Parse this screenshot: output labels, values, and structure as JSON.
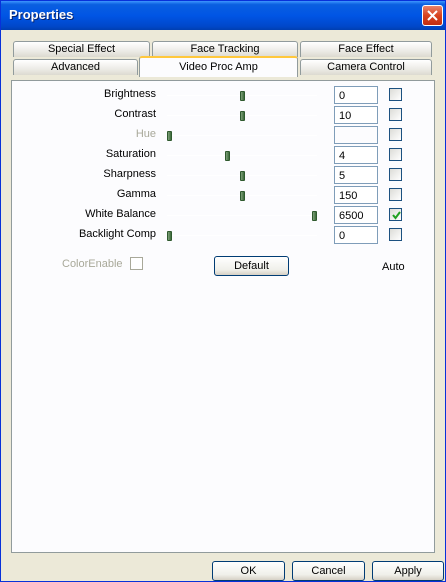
{
  "window": {
    "title": "Properties"
  },
  "tabs_top": [
    "Special Effect",
    "Face Tracking",
    "Face Effect"
  ],
  "tabs_bottom": [
    "Advanced",
    "Video Proc Amp",
    "Camera Control"
  ],
  "active_tab": "Video Proc Amp",
  "controls": [
    {
      "label": "Brightness",
      "value": "0",
      "level": 0.5,
      "auto": false,
      "enabled": true
    },
    {
      "label": "Contrast",
      "value": "10",
      "level": 0.5,
      "auto": false,
      "enabled": true
    },
    {
      "label": "Hue",
      "value": "",
      "level": 0.0,
      "auto": false,
      "enabled": false
    },
    {
      "label": "Saturation",
      "value": "4",
      "level": 0.4,
      "auto": false,
      "enabled": true
    },
    {
      "label": "Sharpness",
      "value": "5",
      "level": 0.5,
      "auto": false,
      "enabled": true
    },
    {
      "label": "Gamma",
      "value": "150",
      "level": 0.5,
      "auto": false,
      "enabled": true
    },
    {
      "label": "White Balance",
      "value": "6500",
      "level": 1.0,
      "auto": true,
      "enabled": true
    },
    {
      "label": "Backlight Comp",
      "value": "0",
      "level": 0.0,
      "auto": false,
      "enabled": true
    }
  ],
  "color_enable": {
    "label": "ColorEnable",
    "checked": false
  },
  "default_button": "Default",
  "auto_label": "Auto",
  "buttons": {
    "ok": "OK",
    "cancel": "Cancel",
    "apply": "Apply"
  }
}
